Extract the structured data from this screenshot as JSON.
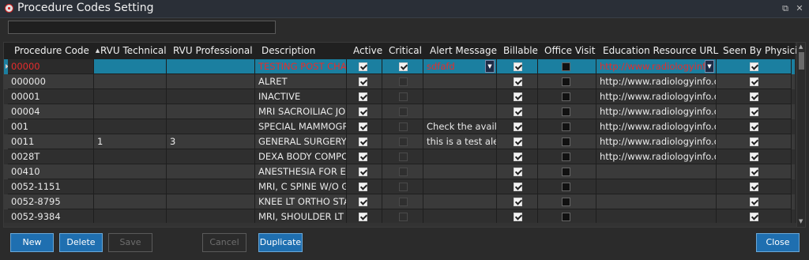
{
  "window": {
    "title": "Procedure Codes Setting",
    "controls": {
      "restore": "⧉",
      "close": "✕"
    }
  },
  "search": {
    "value": ""
  },
  "columns": [
    {
      "key": "code",
      "label": "Procedure Code",
      "sorted": "asc"
    },
    {
      "key": "rvu_tech",
      "label": "RVU Technical"
    },
    {
      "key": "rvu_prof",
      "label": "RVU Professional"
    },
    {
      "key": "desc",
      "label": "Description"
    },
    {
      "key": "active",
      "label": "Active"
    },
    {
      "key": "critical",
      "label": "Critical"
    },
    {
      "key": "alert",
      "label": "Alert Message"
    },
    {
      "key": "billable",
      "label": "Billable"
    },
    {
      "key": "office",
      "label": "Office Visit"
    },
    {
      "key": "edu",
      "label": "Education Resource URL"
    },
    {
      "key": "seen",
      "label": "Seen By Physician"
    }
  ],
  "rows": [
    {
      "code": "00000",
      "rvu_tech": "",
      "rvu_prof": "",
      "desc": "TESTING POST CHAR",
      "active": true,
      "critical": true,
      "alert": "sdfafd",
      "billable": true,
      "office": false,
      "edu": "http://www.radiologyinfo.",
      "seen": true,
      "selected": true
    },
    {
      "code": "000000",
      "rvu_tech": "",
      "rvu_prof": "",
      "desc": "ALRET",
      "active": true,
      "critical": false,
      "alert": "",
      "billable": true,
      "office": false,
      "edu": "http://www.radiologyinfo.org",
      "seen": true
    },
    {
      "code": "00001",
      "rvu_tech": "",
      "rvu_prof": "",
      "desc": "INACTIVE",
      "active": true,
      "critical": false,
      "alert": "",
      "billable": true,
      "office": false,
      "edu": "http://www.radiologyinfo.org",
      "seen": true
    },
    {
      "code": "00004",
      "rvu_tech": "",
      "rvu_prof": "",
      "desc": "MRI SACROILIAC JOI",
      "active": true,
      "critical": false,
      "alert": "",
      "billable": true,
      "office": false,
      "edu": "http://www.radiologyinfo.org",
      "seen": true
    },
    {
      "code": "001",
      "rvu_tech": "",
      "rvu_prof": "",
      "desc": "SPECIAL MAMMOGR",
      "active": true,
      "critical": false,
      "alert": "Check the availab",
      "billable": true,
      "office": false,
      "edu": "http://www.radiologyinfo.org",
      "seen": true
    },
    {
      "code": "0011",
      "rvu_tech": "1",
      "rvu_prof": "3",
      "desc": "GENERAL SURGERY",
      "active": true,
      "critical": false,
      "alert": "this is a test alert",
      "billable": true,
      "office": false,
      "edu": "http://www.radiologyinfo.org",
      "seen": true
    },
    {
      "code": "0028T",
      "rvu_tech": "",
      "rvu_prof": "",
      "desc": "DEXA BODY COMPOS",
      "active": true,
      "critical": false,
      "alert": "",
      "billable": true,
      "office": false,
      "edu": "http://www.radiologyinfo.org",
      "seen": true
    },
    {
      "code": "00410",
      "rvu_tech": "",
      "rvu_prof": "",
      "desc": "ANESTHESIA FOR ELE",
      "active": true,
      "critical": false,
      "alert": "",
      "billable": true,
      "office": false,
      "edu": "",
      "seen": true
    },
    {
      "code": "0052-1151",
      "rvu_tech": "",
      "rvu_prof": "",
      "desc": "MRI, C SPINE  W/O G",
      "active": true,
      "critical": false,
      "alert": "",
      "billable": true,
      "office": false,
      "edu": "",
      "seen": true
    },
    {
      "code": "0052-8795",
      "rvu_tech": "",
      "rvu_prof": "",
      "desc": "KNEE LT ORTHO STAI",
      "active": true,
      "critical": false,
      "alert": "",
      "billable": true,
      "office": false,
      "edu": "",
      "seen": true
    },
    {
      "code": "0052-9384",
      "rvu_tech": "",
      "rvu_prof": "",
      "desc": "MRI, SHOULDER LT (",
      "active": true,
      "critical": false,
      "alert": "",
      "billable": true,
      "office": false,
      "edu": "",
      "seen": true
    }
  ],
  "buttons": {
    "new": "New",
    "delete": "Delete",
    "save": "Save",
    "cancel": "Cancel",
    "duplicate": "Duplicate",
    "close": "Close"
  },
  "colors": {
    "selection": "#1b7fa0",
    "selected_text": "#e62c2c",
    "primary_button": "#1f6fb0"
  }
}
